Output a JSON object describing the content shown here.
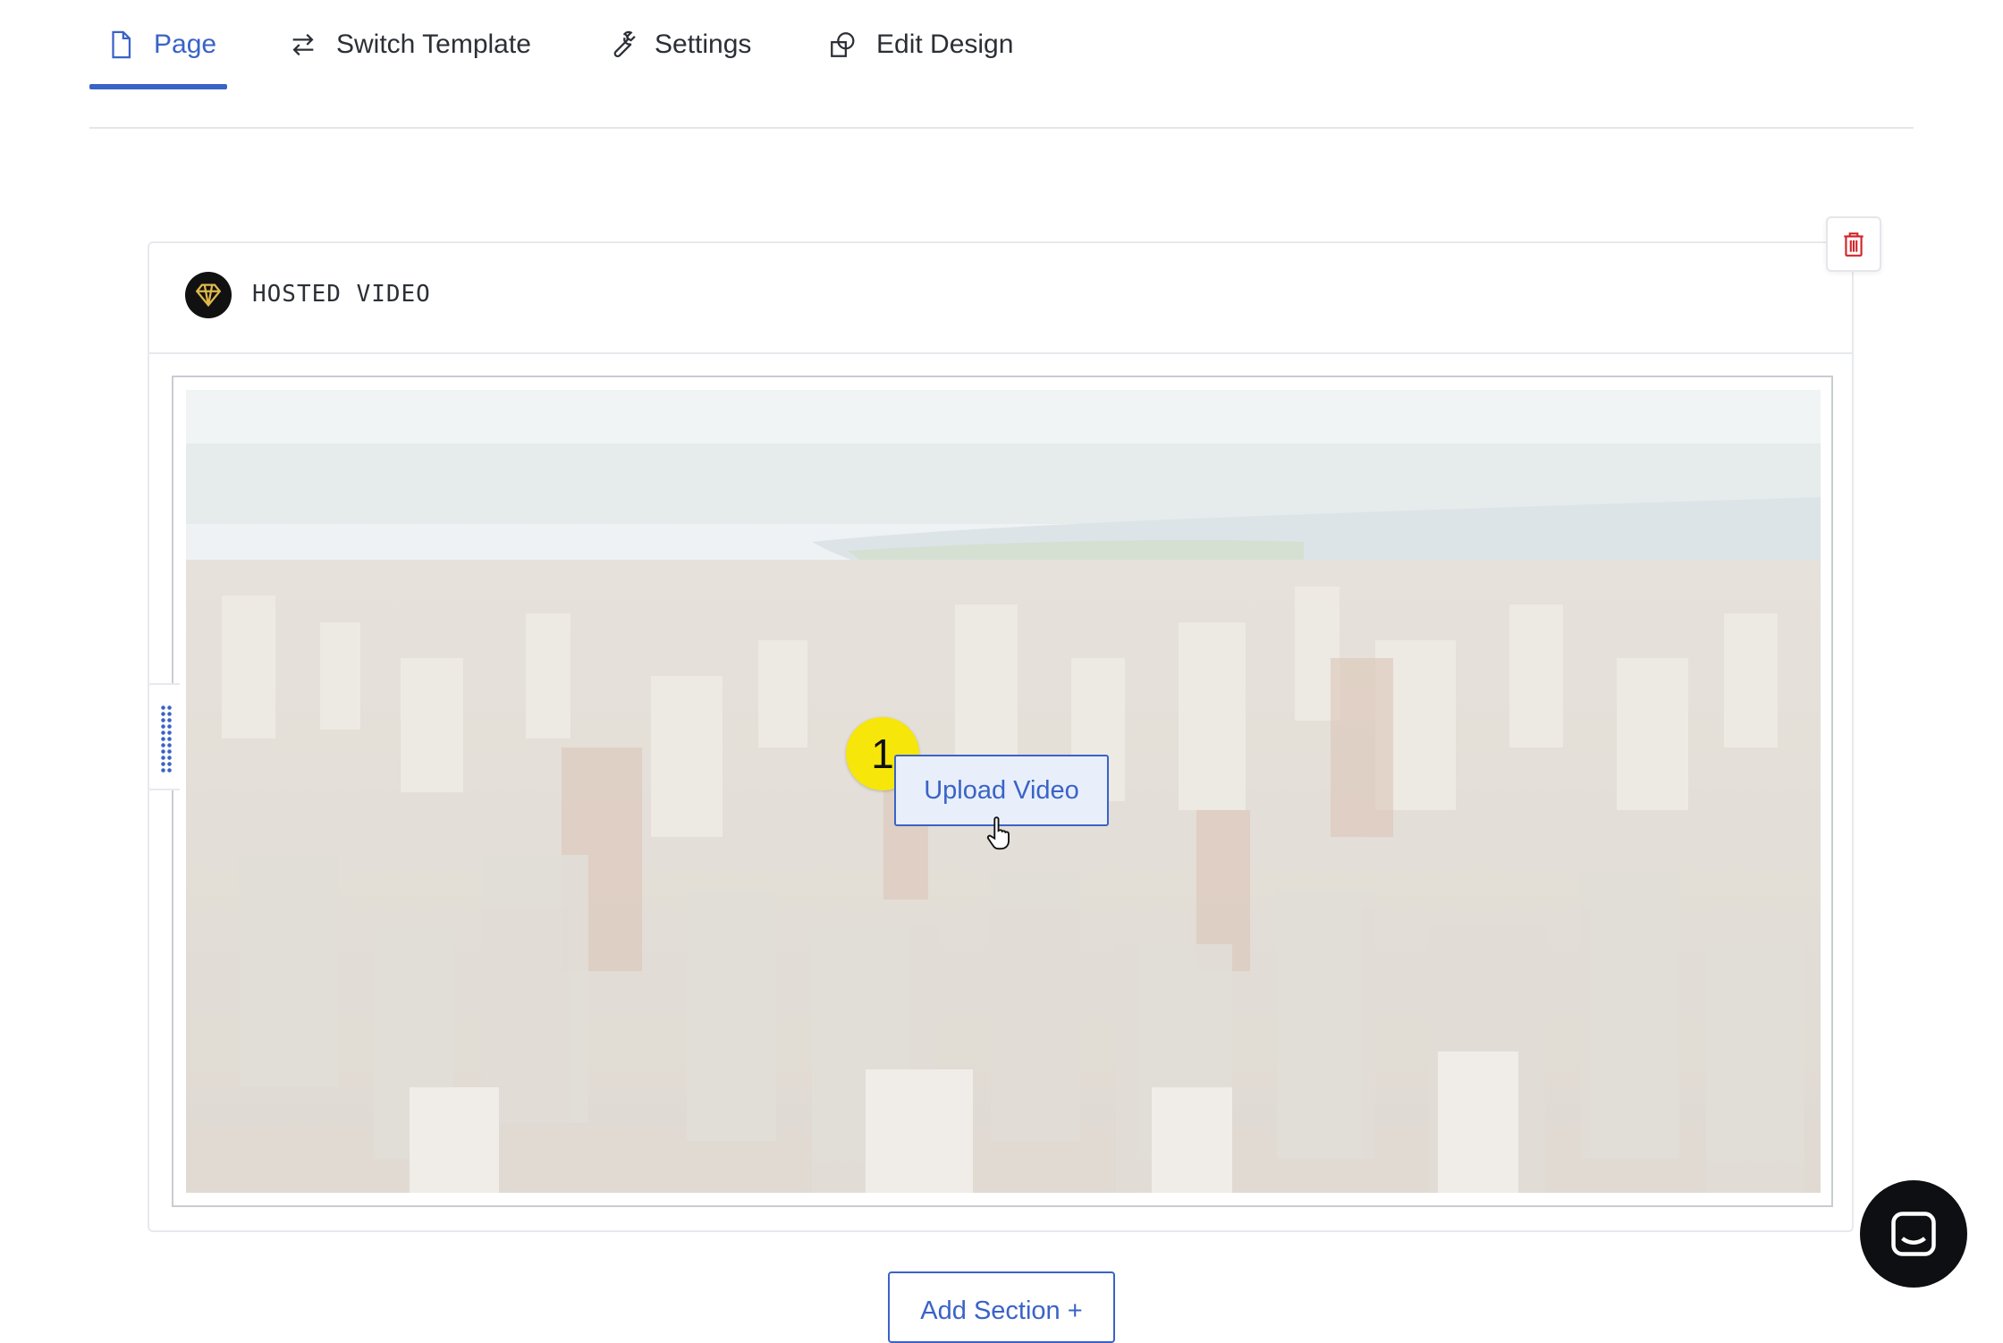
{
  "tabs": [
    {
      "label": "Page",
      "icon": "document-icon",
      "active": true
    },
    {
      "label": "Switch Template",
      "icon": "swap-arrows-icon",
      "active": false
    },
    {
      "label": "Settings",
      "icon": "wrench-icon",
      "active": false
    },
    {
      "label": "Edit Design",
      "icon": "shapes-icon",
      "active": false
    }
  ],
  "section": {
    "title": "HOSTED VIDEO",
    "logo_icon": "diamond-logo-icon",
    "delete_icon": "trash-icon"
  },
  "video": {
    "upload_label": "Upload Video",
    "preview_icon": "city-skyline-preview"
  },
  "step_badge": "1",
  "add_section_label": "Add Section +",
  "chat_icon": "chat-bubble-icon",
  "colors": {
    "accent": "#3a63c7",
    "badge": "#f6e60a",
    "danger": "#d0262a"
  }
}
